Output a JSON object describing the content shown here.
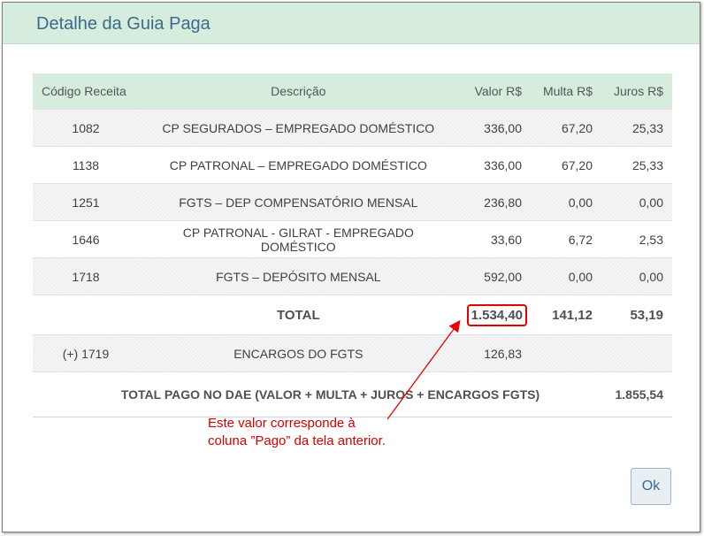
{
  "dialog": {
    "title": "Detalhe da Guia Paga",
    "ok_label": "Ok"
  },
  "table": {
    "headers": {
      "code": "Código Receita",
      "description": "Descrição",
      "valor": "Valor R$",
      "multa": "Multa R$",
      "juros": "Juros R$"
    },
    "rows": [
      {
        "code": "1082",
        "description": "CP SEGURADOS – EMPREGADO DOMÉSTICO",
        "valor": "336,00",
        "multa": "67,20",
        "juros": "25,33"
      },
      {
        "code": "1138",
        "description": "CP PATRONAL – EMPREGADO DOMÉSTICO",
        "valor": "336,00",
        "multa": "67,20",
        "juros": "25,33"
      },
      {
        "code": "1251",
        "description": "FGTS – DEP COMPENSATÓRIO MENSAL",
        "valor": "236,80",
        "multa": "0,00",
        "juros": "0,00"
      },
      {
        "code": "1646",
        "description": "CP PATRONAL - GILRAT - EMPREGADO DOMÉSTICO",
        "valor": "33,60",
        "multa": "6,72",
        "juros": "2,53"
      },
      {
        "code": "1718",
        "description": "FGTS – DEPÓSITO MENSAL",
        "valor": "592,00",
        "multa": "0,00",
        "juros": "0,00"
      }
    ],
    "total": {
      "label": "TOTAL",
      "valor": "1.534,40",
      "multa": "141,12",
      "juros": "53,19"
    },
    "encargos": {
      "code": "(+) 1719",
      "description": "ENCARGOS DO FGTS",
      "valor": "126,83"
    },
    "final": {
      "label": "TOTAL PAGO NO DAE (VALOR + MULTA + JUROS + ENCARGOS FGTS)",
      "value": "1.855,54"
    }
  },
  "annotation": {
    "line1": "Este valor corresponde à",
    "line2": "coluna ”Pago” da tela anterior.",
    "color": "#d40000"
  },
  "colors": {
    "header_bg": "#d6ecdc",
    "title": "#3d6a8c",
    "highlight_border": "#e60000"
  }
}
